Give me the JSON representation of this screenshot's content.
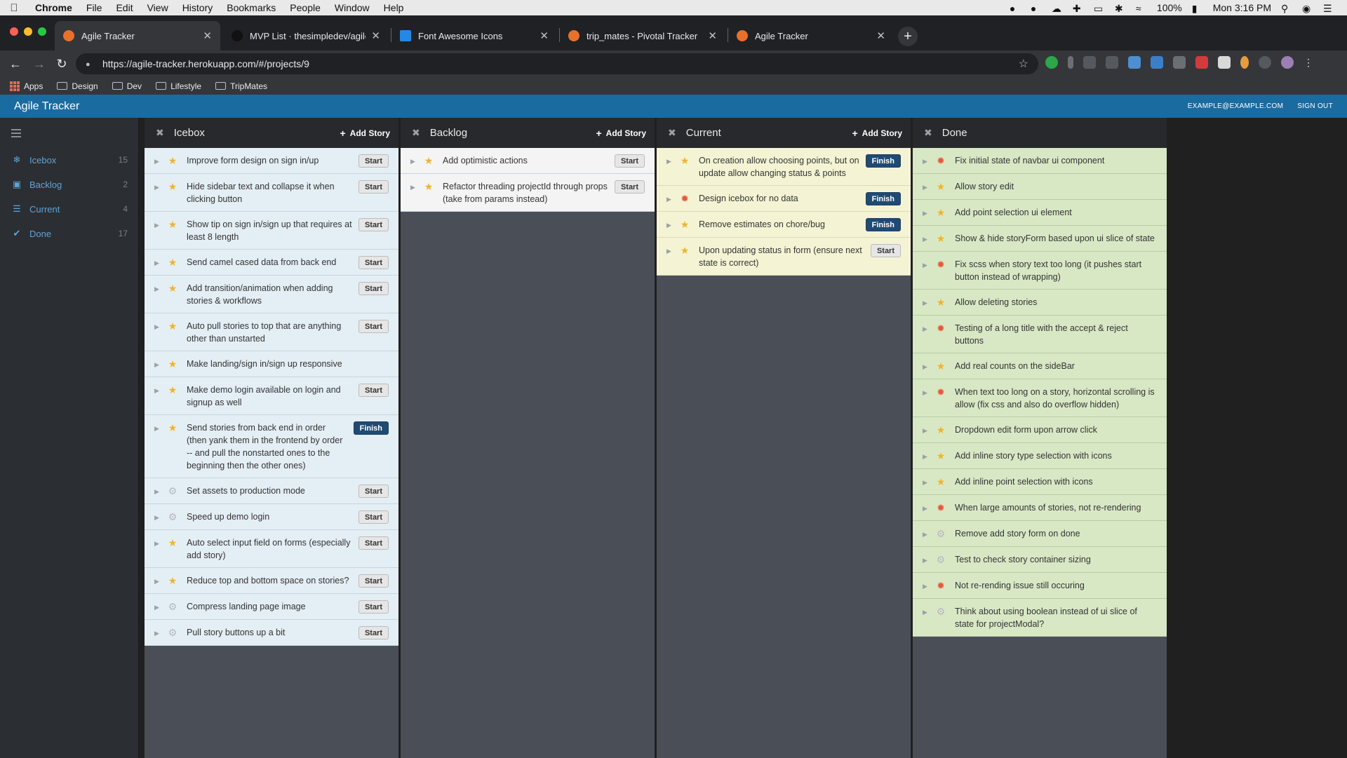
{
  "menubar": {
    "app": "Chrome",
    "items": [
      "File",
      "Edit",
      "View",
      "History",
      "Bookmarks",
      "People",
      "Window",
      "Help"
    ],
    "battery": "100%",
    "clock": "Mon 3:16 PM"
  },
  "tabs": [
    {
      "label": "Agile Tracker",
      "favicon_color": "#e8702a",
      "active": true
    },
    {
      "label": "MVP List · thesimpledev/agile_",
      "favicon_color": "#111111",
      "active": false
    },
    {
      "label": "Font Awesome Icons",
      "favicon_color": "#228ae6",
      "active": false
    },
    {
      "label": "trip_mates - Pivotal Tracker",
      "favicon_color": "#e8702a",
      "active": false
    },
    {
      "label": "Agile Tracker",
      "favicon_color": "#e8702a",
      "active": false
    }
  ],
  "address": {
    "url": "https://agile-tracker.herokuapp.com/#/projects/9"
  },
  "bookmarks": [
    "Apps",
    "Design",
    "Dev",
    "Lifestyle",
    "TripMates"
  ],
  "header": {
    "brand": "Agile Tracker",
    "email": "EXAMPLE@EXAMPLE.COM",
    "signout": "SIGN OUT",
    "color": "#1a6ba0"
  },
  "sidebar": {
    "items": [
      {
        "label": "Icebox",
        "count": "15",
        "icon": "snowflake-icon"
      },
      {
        "label": "Backlog",
        "count": "2",
        "icon": "inbox-icon"
      },
      {
        "label": "Current",
        "count": "4",
        "icon": "list-icon"
      },
      {
        "label": "Done",
        "count": "17",
        "icon": "check-icon"
      }
    ]
  },
  "columns": [
    {
      "title": "Icebox",
      "add_label": "Add Story",
      "stories": [
        {
          "type": "feature",
          "text": "Improve form design on sign in/up",
          "button": "Start"
        },
        {
          "type": "feature",
          "text": "Hide sidebar text and collapse it when clicking button",
          "button": "Start"
        },
        {
          "type": "feature",
          "text": "Show tip on sign in/sign up that requires at least 8 length",
          "button": "Start"
        },
        {
          "type": "feature",
          "text": "Send camel cased data from back end",
          "button": "Start"
        },
        {
          "type": "feature",
          "text": "Add transition/animation when adding stories & workflows",
          "button": "Start"
        },
        {
          "type": "feature",
          "text": "Auto pull stories to top that are anything other than unstarted",
          "button": "Start"
        },
        {
          "type": "feature",
          "text": "Make landing/sign in/sign up responsive",
          "button": ""
        },
        {
          "type": "feature",
          "text": "Make demo login available on login and signup as well",
          "button": "Start"
        },
        {
          "type": "feature",
          "text": "Send stories from back end in order (then yank them in the frontend by order -- and pull the nonstarted ones to the beginning then the other ones)",
          "button": "Finish"
        },
        {
          "type": "chore",
          "text": "Set assets to production mode",
          "button": "Start"
        },
        {
          "type": "chore",
          "text": "Speed up demo login",
          "button": "Start"
        },
        {
          "type": "feature",
          "text": "Auto select input field on forms (especially add story)",
          "button": "Start"
        },
        {
          "type": "feature",
          "text": "Reduce top and bottom space on stories?",
          "button": "Start"
        },
        {
          "type": "chore",
          "text": "Compress landing page image",
          "button": "Start"
        },
        {
          "type": "chore",
          "text": "Pull story buttons up a bit",
          "button": "Start"
        }
      ]
    },
    {
      "title": "Backlog",
      "add_label": "Add Story",
      "stories": [
        {
          "type": "feature",
          "text": "Add optimistic actions",
          "button": "Start"
        },
        {
          "type": "feature",
          "text": "Refactor threading projectId through props (take from params instead)",
          "button": "Start"
        }
      ]
    },
    {
      "title": "Current",
      "add_label": "Add Story",
      "stories": [
        {
          "type": "feature",
          "text": "On creation allow choosing points, but on update allow changing status & points",
          "button": "Finish"
        },
        {
          "type": "bug",
          "text": "Design icebox for no data",
          "button": "Finish"
        },
        {
          "type": "feature",
          "text": "Remove estimates on chore/bug",
          "button": "Finish"
        },
        {
          "type": "feature",
          "text": "Upon updating status in form (ensure next state is correct)",
          "button": "Start"
        }
      ]
    },
    {
      "title": "Done",
      "add_label": "",
      "stories": [
        {
          "type": "bug",
          "text": "Fix initial state of navbar ui component",
          "button": ""
        },
        {
          "type": "feature",
          "text": "Allow story edit",
          "button": ""
        },
        {
          "type": "feature",
          "text": "Add point selection ui element",
          "button": ""
        },
        {
          "type": "feature",
          "text": "Show & hide storyForm based upon ui slice of state",
          "button": ""
        },
        {
          "type": "bug",
          "text": "Fix scss when story text too long (it pushes start button instead of wrapping)",
          "button": ""
        },
        {
          "type": "feature",
          "text": "Allow deleting stories",
          "button": ""
        },
        {
          "type": "bug",
          "text": "Testing of a long title with the accept & reject buttons",
          "button": ""
        },
        {
          "type": "feature",
          "text": "Add real counts on the sideBar",
          "button": ""
        },
        {
          "type": "bug",
          "text": "When text too long on a story, horizontal scrolling is allow (fix css and also do overflow hidden)",
          "button": ""
        },
        {
          "type": "feature",
          "text": "Dropdown edit form upon arrow click",
          "button": ""
        },
        {
          "type": "feature",
          "text": "Add inline story type selection with icons",
          "button": ""
        },
        {
          "type": "feature",
          "text": "Add inline point selection with icons",
          "button": ""
        },
        {
          "type": "bug",
          "text": "When large amounts of stories, not re-rendering",
          "button": ""
        },
        {
          "type": "chore",
          "text": "Remove add story form on done",
          "button": ""
        },
        {
          "type": "chore",
          "text": "Test to check story container sizing",
          "button": ""
        },
        {
          "type": "bug",
          "text": "Not re-rending issue still occuring",
          "button": ""
        },
        {
          "type": "chore",
          "text": "Think about using boolean instead of ui slice of state for projectModal?",
          "button": ""
        }
      ]
    }
  ]
}
